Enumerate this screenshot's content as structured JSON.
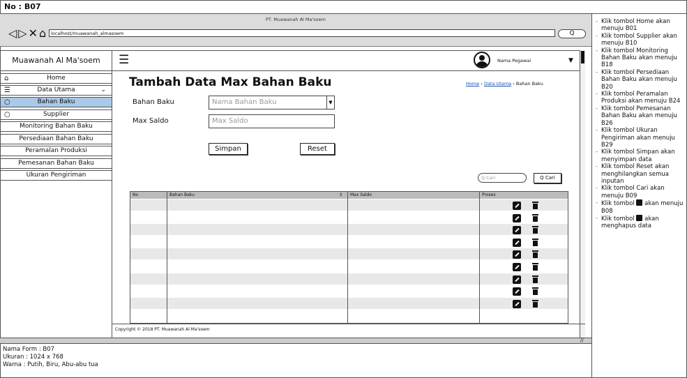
{
  "header": {
    "label": "No : B07"
  },
  "browser": {
    "title": "PT. Muawanah Al Ma'soem",
    "url": "localhost/muawanah_almasoem",
    "nav_icons": "◁▷✕⌂",
    "search_glyph": "Q"
  },
  "brand": "Muawanah Al Ma'soem",
  "topbar": {
    "pegawai": "Nama Pegawai"
  },
  "sidebar": {
    "items": [
      {
        "label": "Home",
        "icon": "home-icon"
      },
      {
        "label": "Data Utama",
        "icon": "database-icon"
      },
      {
        "label": "Bahan Baku",
        "icon": "circle-icon"
      },
      {
        "label": "Supplier",
        "icon": "circle-icon"
      },
      {
        "label": "Monitoring Bahan Baku"
      },
      {
        "label": "Persediaan Bahan Baku"
      },
      {
        "label": "Peramalan Produksi"
      },
      {
        "label": "Pemesanan Bahan Baku"
      },
      {
        "label": "Ukuran Pengiriman"
      }
    ]
  },
  "page": {
    "title": "Tambah Data Max Bahan Baku",
    "breadcrumb": {
      "home": "Home",
      "data_utama": "Data Utama",
      "current": "Bahan Baku"
    }
  },
  "form": {
    "bahan_baku_label": "Bahan Baku",
    "bahan_baku_placeholder": "Nama Bahan Baku",
    "max_saldo_label": "Max Saldo",
    "max_saldo_placeholder": "Max Saldo",
    "simpan_label": "Simpan",
    "reset_label": "Reset"
  },
  "search": {
    "placeholder": "Q Cari",
    "button_label": "Q Cari"
  },
  "table": {
    "columns": [
      "No",
      "Bahan Baku",
      "Max Saldo",
      "Proses"
    ],
    "rows": 10
  },
  "footer": {
    "copyright": "Copyright © 2018 PT. Muawanah Al Ma'soem"
  },
  "form_info": {
    "nama_form": "Nama Form : B07",
    "ukuran": "Ukuran : 1024 x 768",
    "warna": "Warna : Putih, Biru, Abu-abu tua"
  },
  "notes": [
    "Klik tombol Home akan menuju B01",
    "Klik tombol Supplier akan menuju B10",
    "Klik tombol Monitoring Bahan Baku akan menuju B18",
    "Klik tombol Persediaan Bahan Baku akan menuju B20",
    "Klik tombol Peramalan Produksi akan menuju B24",
    "Klik tombol Pemesanan Bahan Baku akan menuju B26",
    "Klik tombol Ukuran Pengiriman akan menuju B29",
    "Klik tombol Simpan akan menyimpan data",
    "Klik tombol Reset akan menghilangkan semua inputan",
    "Klik tombol Cari akan menuju B09"
  ],
  "note_edit": {
    "pre": "Klik tombol",
    "post": "akan menuju B08"
  },
  "note_delete": {
    "pre": "Klik tombol",
    "post": "akan menghapus data"
  },
  "colors": {
    "selected": "#aac8e8",
    "browser": "#dcdcdc",
    "row_alt": "#e8e8e8"
  }
}
